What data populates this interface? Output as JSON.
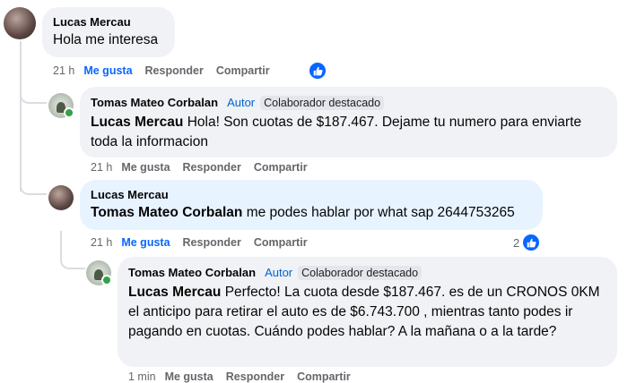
{
  "comments": [
    {
      "author": "Lucas Mercau",
      "text": "Hola me interesa",
      "time": "21 h",
      "like": "Me gusta",
      "reply": "Responder",
      "share": "Compartir"
    },
    {
      "author": "Tomas Mateo Corbalan",
      "author_tag": "Autor",
      "badge": "Colaborador destacado",
      "mention": "Lucas Mercau",
      "text": " Hola! Son cuotas de $187.467. Dejame tu numero para enviarte toda la informacion",
      "time": "21 h",
      "like": "Me gusta",
      "reply": "Responder",
      "share": "Compartir"
    },
    {
      "author": "Lucas Mercau",
      "mention": "Tomas Mateo Corbalan",
      "text": " me podes hablar por what sap 2644753265",
      "time": "21 h",
      "like": "Me gusta",
      "reply": "Responder",
      "share": "Compartir",
      "reaction_count": "2"
    },
    {
      "author": "Tomas Mateo Corbalan",
      "author_tag": "Autor",
      "badge": "Colaborador destacado",
      "mention": "Lucas Mercau",
      "text": " Perfecto! La cuota desde $187.467. es de un CRONOS 0KM el anticipo para retirar el auto es de $6.743.700 , mientras tanto podes ir pagando en cuotas. Cuándo podes hablar? A la mañana o a la tarde?",
      "time": "1 min",
      "like": "Me gusta",
      "reply": "Responder",
      "share": "Compartir"
    }
  ],
  "colors": {
    "accent": "#0866ff",
    "bubble": "#f0f2f5",
    "bubble_selected": "#e7f3ff",
    "author_tag": "#0064d1"
  },
  "icons": [
    "like-reaction-icon",
    "online-status-icon"
  ]
}
